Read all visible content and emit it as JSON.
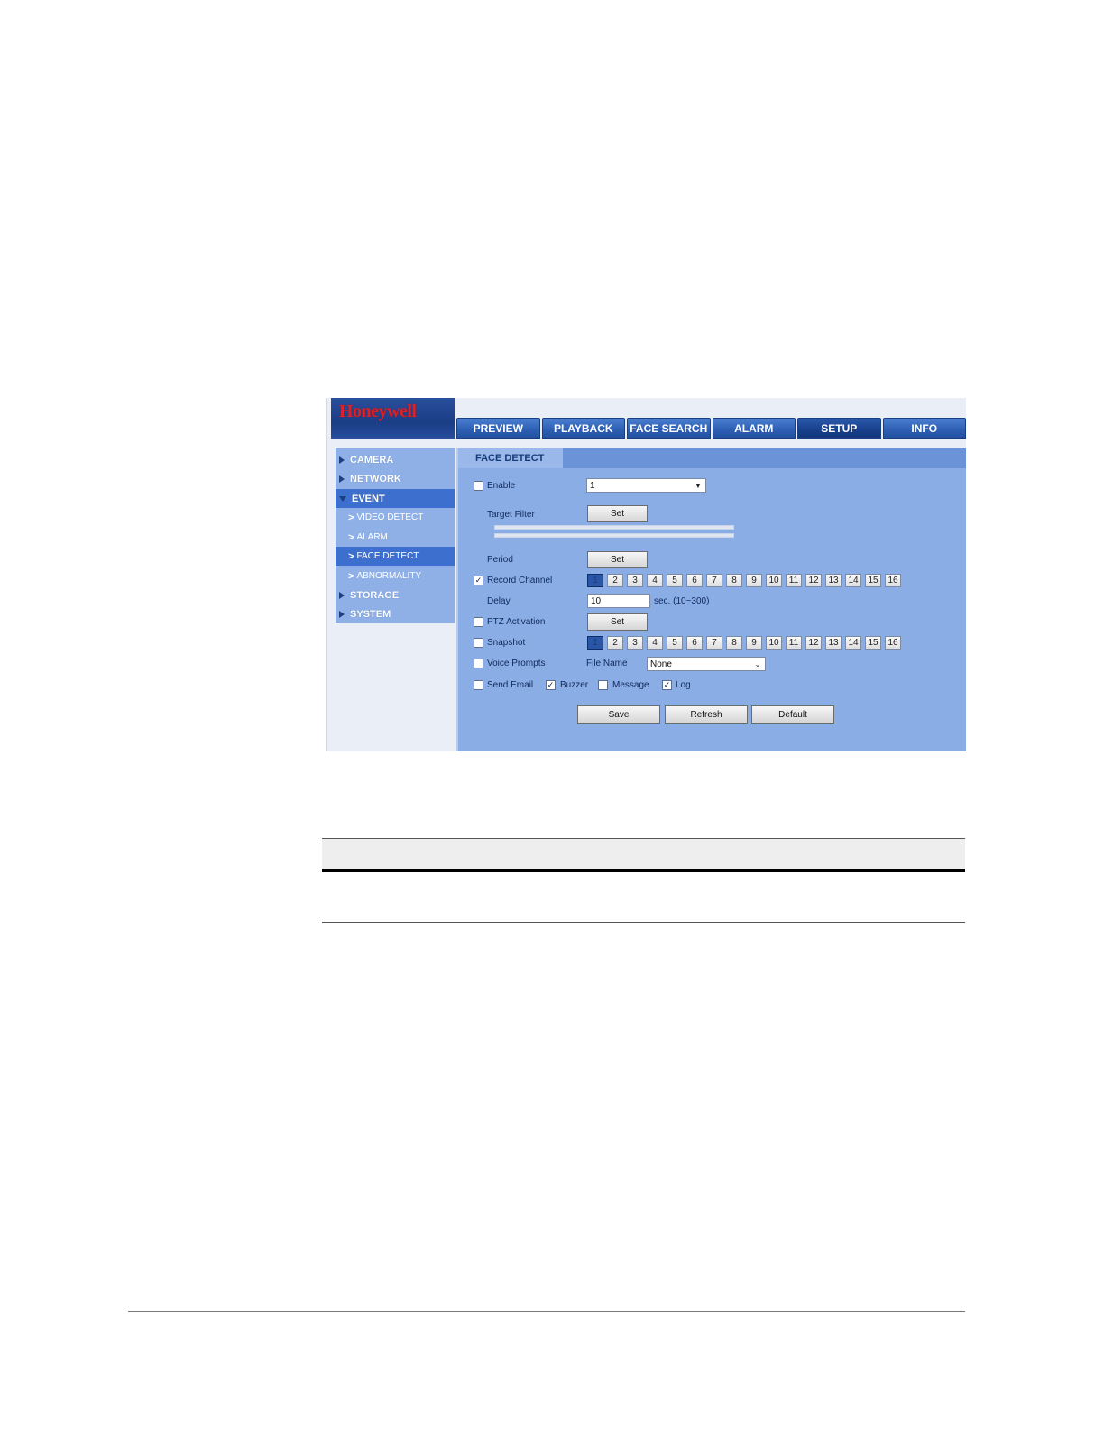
{
  "app": {
    "brand": "Honeywell"
  },
  "nav": {
    "tabs": [
      "PREVIEW",
      "PLAYBACK",
      "FACE SEARCH",
      "ALARM",
      "SETUP",
      "INFO"
    ],
    "active": "SETUP"
  },
  "sidebar": {
    "camera": "CAMERA",
    "network": "NETWORK",
    "event": "EVENT",
    "video_detect": "VIDEO DETECT",
    "alarm": "ALARM",
    "face_detect": "FACE DETECT",
    "abnormality": "ABNORMALITY",
    "storage": "STORAGE",
    "system": "SYSTEM"
  },
  "panel": {
    "title": "FACE DETECT",
    "enable_label": "Enable",
    "enable_checked": false,
    "channel_value": "1",
    "target_filter_label": "Target Filter",
    "period_label": "Period",
    "record_channel_label": "Record Channel",
    "record_channel_checked": true,
    "delay_label": "Delay",
    "delay_value": "10",
    "delay_hint": "sec. (10~300)",
    "ptz_label": "PTZ Activation",
    "ptz_checked": false,
    "snapshot_label": "Snapshot",
    "snapshot_checked": false,
    "voice_label": "Voice Prompts",
    "voice_checked": false,
    "file_name_label": "File Name",
    "file_name_value": "None",
    "send_email_label": "Send Email",
    "buzzer_label": "Buzzer",
    "message_label": "Message",
    "log_label": "Log",
    "set_label": "Set",
    "save_label": "Save",
    "refresh_label": "Refresh",
    "default_label": "Default",
    "channels": [
      "1",
      "2",
      "3",
      "4",
      "5",
      "6",
      "7",
      "8",
      "9",
      "10",
      "11",
      "12",
      "13",
      "14",
      "15",
      "16"
    ]
  },
  "colors": {
    "accent": "#2d5fb4",
    "brand": "#d8232a",
    "panel": "#8aade6"
  }
}
